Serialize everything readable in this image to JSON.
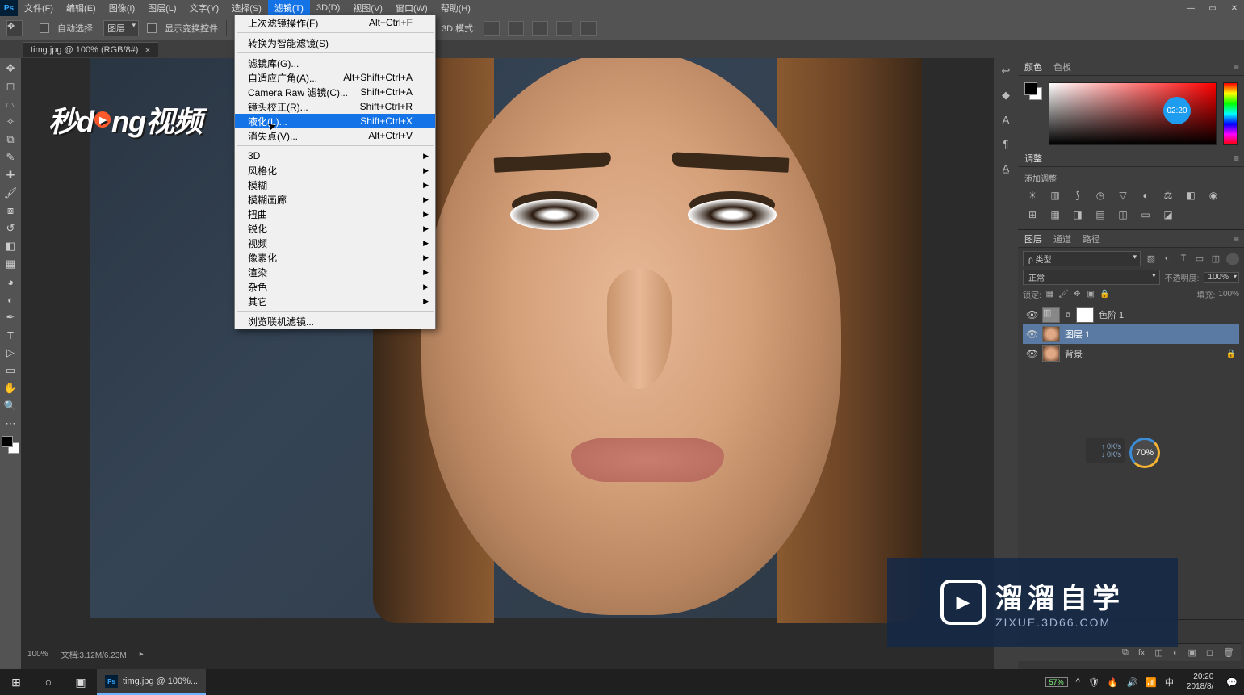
{
  "app": {
    "icon_label": "Ps",
    "menubar": [
      "文件(F)",
      "编辑(E)",
      "图像(I)",
      "图层(L)",
      "文字(Y)",
      "选择(S)",
      "滤镜(T)",
      "3D(D)",
      "视图(V)",
      "窗口(W)",
      "帮助(H)"
    ],
    "active_menu_index": 6
  },
  "options": {
    "auto_select_label": "自动选择:",
    "auto_select_value": "图层",
    "show_transform_label": "显示变换控件",
    "mode_label": "3D 模式:"
  },
  "doc_tab": {
    "title": "timg.jpg @ 100% (RGB/8#)"
  },
  "dropdown": {
    "items": [
      {
        "label": "上次滤镜操作(F)",
        "shortcut": "Alt+Ctrl+F"
      },
      {
        "sep": true
      },
      {
        "label": "转换为智能滤镜(S)"
      },
      {
        "sep": true
      },
      {
        "label": "滤镜库(G)..."
      },
      {
        "label": "自适应广角(A)...",
        "shortcut": "Alt+Shift+Ctrl+A"
      },
      {
        "label": "Camera Raw 滤镜(C)...",
        "shortcut": "Shift+Ctrl+A"
      },
      {
        "label": "镜头校正(R)...",
        "shortcut": "Shift+Ctrl+R"
      },
      {
        "label": "液化(L)...",
        "shortcut": "Shift+Ctrl+X",
        "highlight": true
      },
      {
        "label": "消失点(V)...",
        "shortcut": "Alt+Ctrl+V"
      },
      {
        "sep": true
      },
      {
        "label": "3D",
        "submenu": true
      },
      {
        "label": "风格化",
        "submenu": true
      },
      {
        "label": "模糊",
        "submenu": true
      },
      {
        "label": "模糊画廊",
        "submenu": true
      },
      {
        "label": "扭曲",
        "submenu": true
      },
      {
        "label": "锐化",
        "submenu": true
      },
      {
        "label": "视频",
        "submenu": true
      },
      {
        "label": "像素化",
        "submenu": true
      },
      {
        "label": "渲染",
        "submenu": true
      },
      {
        "label": "杂色",
        "submenu": true
      },
      {
        "label": "其它",
        "submenu": true
      },
      {
        "sep": true
      },
      {
        "label": "浏览联机滤镜..."
      }
    ]
  },
  "watermark_tl": {
    "text_a": "秒d",
    "text_b": "ng视频"
  },
  "right_tabs": {
    "color": [
      "颜色",
      "色板"
    ],
    "adjustments": [
      "调整"
    ],
    "adj_hint": "添加调整",
    "layers": [
      "图层",
      "通道",
      "路径"
    ]
  },
  "layers": {
    "kind_label": "ρ 类型",
    "blend_mode": "正常",
    "opacity_label": "不透明度:",
    "opacity_value": "100%",
    "lock_label": "锁定:",
    "fill_label": "填充:",
    "fill_value": "100%",
    "items": [
      {
        "name": "色阶 1",
        "type": "adjust"
      },
      {
        "name": "图层 1",
        "type": "pixel",
        "selected": true
      },
      {
        "name": "背景",
        "type": "pixel",
        "locked": true
      }
    ]
  },
  "status": {
    "zoom": "100%",
    "doc_info": "文档:3.12M/6.23M"
  },
  "overlays": {
    "progress": "70%",
    "net_up": "↑ 0K/s",
    "net_down": "↓ 0K/s",
    "time_badge": "02:20"
  },
  "watermark_br": {
    "cn": "溜溜自学",
    "en": "ZIXUE.3D66.COM"
  },
  "taskbar": {
    "app_title": "timg.jpg @ 100%...",
    "battery": "57%",
    "clock_time": "20:20",
    "clock_date": "2018/8/"
  }
}
